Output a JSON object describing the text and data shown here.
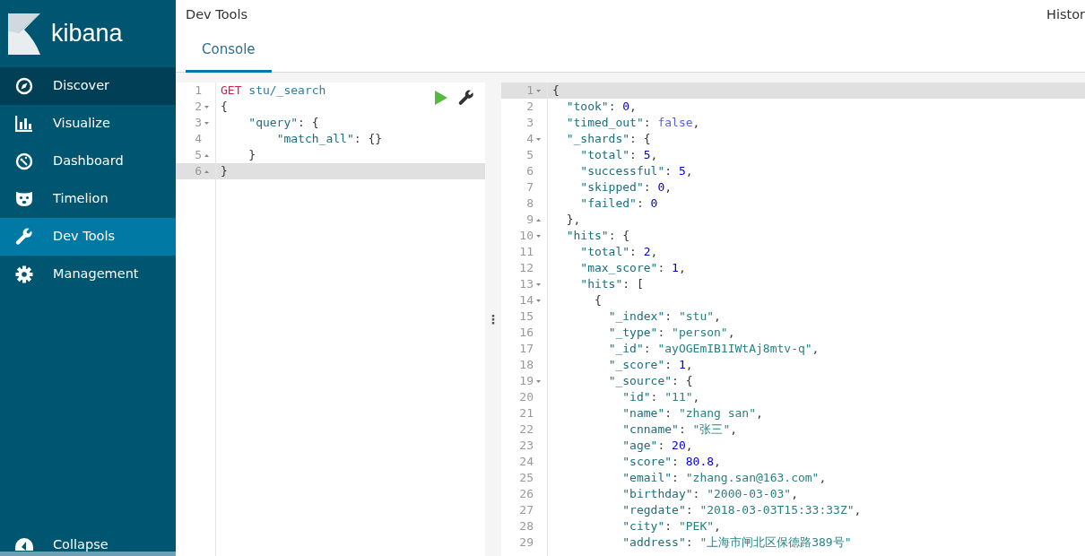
{
  "sidebar": {
    "logo": "kibana",
    "items": [
      {
        "label": "Discover",
        "selected": false,
        "hover": true
      },
      {
        "label": "Visualize",
        "selected": false,
        "hover": false
      },
      {
        "label": "Dashboard",
        "selected": false,
        "hover": false
      },
      {
        "label": "Timelion",
        "selected": false,
        "hover": false
      },
      {
        "label": "Dev Tools",
        "selected": true,
        "hover": false
      },
      {
        "label": "Management",
        "selected": false,
        "hover": false
      }
    ],
    "collapse": "Collapse"
  },
  "header": {
    "title": "Dev Tools",
    "history": "Histor"
  },
  "tabs": [
    {
      "label": "Console",
      "selected": true
    }
  ],
  "request_editor": {
    "lines": [
      {
        "number": "1",
        "kind": "plain",
        "active": false,
        "text": "GET stu/_search"
      },
      {
        "number": "2",
        "kind": "fold-start",
        "active": false,
        "text": "{"
      },
      {
        "number": "3",
        "kind": "fold-start",
        "active": false,
        "text": "    \"query\": {"
      },
      {
        "number": "4",
        "kind": "plain",
        "active": false,
        "text": "        \"match_all\": {}"
      },
      {
        "number": "5",
        "kind": "fold-end",
        "active": false,
        "text": "    }"
      },
      {
        "number": "6",
        "kind": "fold-end",
        "active": true,
        "text": "}"
      }
    ]
  },
  "divider": "⋮",
  "response_editor": {
    "lines": [
      {
        "number": "1",
        "kind": "fold-start",
        "active": true,
        "text": "{"
      },
      {
        "number": "2",
        "kind": "plain",
        "active": false,
        "text": "  \"took\": 0,"
      },
      {
        "number": "3",
        "kind": "plain",
        "active": false,
        "text": "  \"timed_out\": false,"
      },
      {
        "number": "4",
        "kind": "fold-start",
        "active": false,
        "text": "  \"_shards\": {"
      },
      {
        "number": "5",
        "kind": "plain",
        "active": false,
        "text": "    \"total\": 5,"
      },
      {
        "number": "6",
        "kind": "plain",
        "active": false,
        "text": "    \"successful\": 5,"
      },
      {
        "number": "7",
        "kind": "plain",
        "active": false,
        "text": "    \"skipped\": 0,"
      },
      {
        "number": "8",
        "kind": "plain",
        "active": false,
        "text": "    \"failed\": 0"
      },
      {
        "number": "9",
        "kind": "fold-end",
        "active": false,
        "text": "  },"
      },
      {
        "number": "10",
        "kind": "fold-start",
        "active": false,
        "text": "  \"hits\": {"
      },
      {
        "number": "11",
        "kind": "plain",
        "active": false,
        "text": "    \"total\": 2,"
      },
      {
        "number": "12",
        "kind": "plain",
        "active": false,
        "text": "    \"max_score\": 1,"
      },
      {
        "number": "13",
        "kind": "fold-start",
        "active": false,
        "text": "    \"hits\": ["
      },
      {
        "number": "14",
        "kind": "fold-start",
        "active": false,
        "text": "      {"
      },
      {
        "number": "15",
        "kind": "plain",
        "active": false,
        "text": "        \"_index\": \"stu\","
      },
      {
        "number": "16",
        "kind": "plain",
        "active": false,
        "text": "        \"_type\": \"person\","
      },
      {
        "number": "17",
        "kind": "plain",
        "active": false,
        "text": "        \"_id\": \"ayOGEmIB1IWtAj8mtv-q\","
      },
      {
        "number": "18",
        "kind": "plain",
        "active": false,
        "text": "        \"_score\": 1,"
      },
      {
        "number": "19",
        "kind": "fold-start",
        "active": false,
        "text": "        \"_source\": {"
      },
      {
        "number": "20",
        "kind": "plain",
        "active": false,
        "text": "          \"id\": \"11\","
      },
      {
        "number": "21",
        "kind": "plain",
        "active": false,
        "text": "          \"name\": \"zhang san\","
      },
      {
        "number": "22",
        "kind": "plain",
        "active": false,
        "text": "          \"cnname\": \"张三\","
      },
      {
        "number": "23",
        "kind": "plain",
        "active": false,
        "text": "          \"age\": 20,"
      },
      {
        "number": "24",
        "kind": "plain",
        "active": false,
        "text": "          \"score\": 80.8,"
      },
      {
        "number": "25",
        "kind": "plain",
        "active": false,
        "text": "          \"email\": \"zhang.san@163.com\","
      },
      {
        "number": "26",
        "kind": "plain",
        "active": false,
        "text": "          \"birthday\": \"2000-03-03\","
      },
      {
        "number": "27",
        "kind": "plain",
        "active": false,
        "text": "          \"regdate\": \"2018-03-03T15:33:33Z\","
      },
      {
        "number": "28",
        "kind": "plain",
        "active": false,
        "text": "          \"city\": \"PEK\","
      },
      {
        "number": "29",
        "kind": "plain",
        "active": false,
        "text": "          \"address\": \"上海市闸北区保德路389号\""
      }
    ]
  }
}
